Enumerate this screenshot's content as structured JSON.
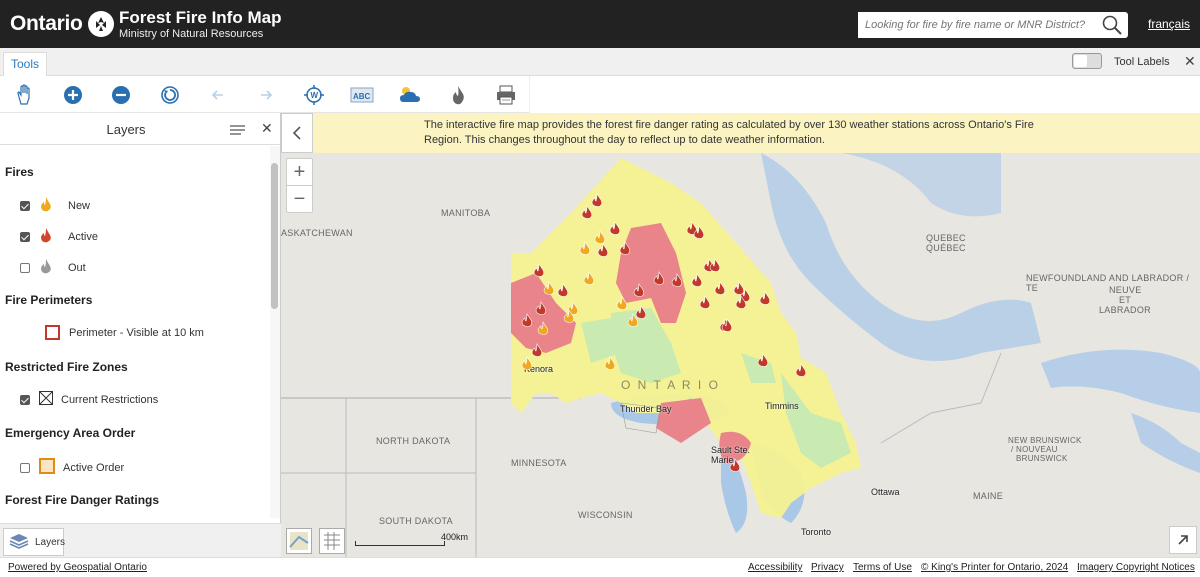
{
  "header": {
    "logo_text": "Ontario",
    "title": "Forest Fire Info Map",
    "subtitle": "Ministry of Natural Resources",
    "search_placeholder": "Looking for fire by fire name or MNR District?",
    "lang_link": "français"
  },
  "toolbar": {
    "tab_label": "Tools",
    "tool_labels_toggle": "Tool Labels",
    "icons": [
      "pan-hand-icon",
      "zoom-in-icon",
      "zoom-out-icon",
      "refresh-icon",
      "back-arrow-icon",
      "forward-arrow-icon",
      "locate-icon",
      "label-abc-icon",
      "weather-icon",
      "fire-icon",
      "print-icon"
    ]
  },
  "layers_panel": {
    "title": "Layers",
    "sections": {
      "fires": "Fires",
      "fire_new": "New",
      "fire_active": "Active",
      "fire_out": "Out",
      "perimeters": "Fire Perimeters",
      "perimeter_item": "Perimeter - Visible at 10 km",
      "restricted": "Restricted Fire Zones",
      "restricted_item": "Current Restrictions",
      "emergency": "Emergency Area Order",
      "emergency_item": "Active Order",
      "danger": "Forest Fire Danger Ratings"
    },
    "checks": {
      "new": true,
      "active": true,
      "out": false,
      "restrictions": true,
      "active_order": false
    },
    "footer_button": "Layers"
  },
  "map": {
    "info_text": "The interactive fire map provides the forest fire danger rating as calculated by over 130 weather stations across Ontario's Fire Region. This changes throughout the day to reflect up to date weather information.",
    "labels": {
      "manitoba": "MANITOBA",
      "saskatchewan": "ASKATCHEWAN",
      "quebec_en": "QUEBEC",
      "quebec_fr": "QUÉBEC",
      "newfoundland": "NEWFOUNDLAND AND LABRADOR / TE",
      "neuve": "NEUVE",
      "et": "ET",
      "labrador": "LABRADOR",
      "ontario": "O N T A R I O",
      "north_dakota": "NORTH DAKOTA",
      "minnesota": "MINNESOTA",
      "south_dakota": "SOUTH DAKOTA",
      "wisconsin": "WISCONSIN",
      "new_brunswick": "NEW BRUNSWICK",
      "nouveau": "/ NOUVEAU",
      "brunswick": "BRUNSWICK",
      "maine": "MAINE"
    },
    "cities": {
      "kenora": "Kenora",
      "thunder_bay": "Thunder Bay",
      "timmins": "Timmins",
      "sault": "Sault Ste.",
      "marie": "Marie",
      "ottawa": "Ottawa",
      "toronto": "Toronto"
    },
    "scale_label": "400km",
    "colors": {
      "low": "#c9eab0",
      "moderate": "#f5f291",
      "high": "#e8848a",
      "fire_active": "#c0392b",
      "fire_new": "#f0a820"
    }
  },
  "footer": {
    "powered": "Powered by Geospatial Ontario",
    "accessibility": "Accessibility",
    "privacy": "Privacy",
    "terms": "Terms of Use",
    "copyright": "© King's Printer for Ontario, 2024",
    "imagery": "Imagery Copyright Notices"
  }
}
